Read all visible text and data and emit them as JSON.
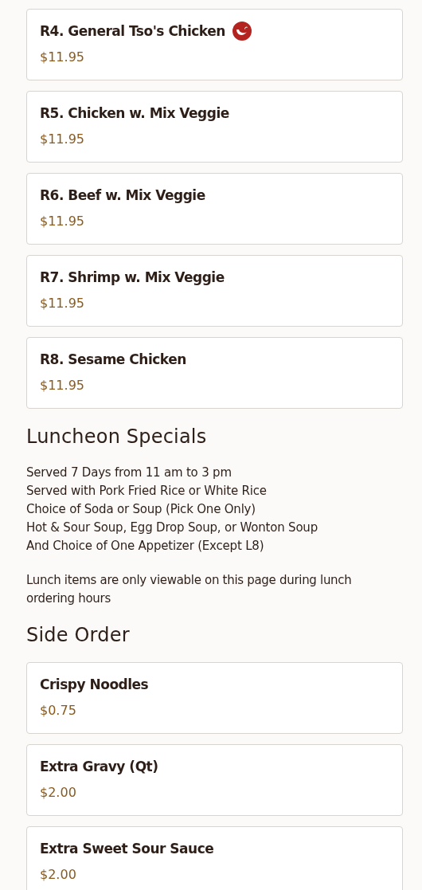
{
  "items": [
    {
      "name": "R4. General Tso's Chicken",
      "spicy": true,
      "price": "$11.95"
    },
    {
      "name": "R5. Chicken w. Mix Veggie",
      "spicy": false,
      "price": "$11.95"
    },
    {
      "name": "R6. Beef w. Mix Veggie",
      "spicy": false,
      "price": "$11.95"
    },
    {
      "name": "R7. Shrimp w. Mix Veggie",
      "spicy": false,
      "price": "$11.95"
    },
    {
      "name": "R8. Sesame Chicken",
      "spicy": false,
      "price": "$11.95"
    }
  ],
  "sections": [
    {
      "title": "Luncheon Specials",
      "lines": [
        "Served 7 Days from 11 am to 3 pm",
        "Served with Pork Fried Rice or White Rice",
        "Choice of Soda or Soup (Pick One Only)",
        "Hot & Sour Soup, Egg Drop Soup, or Wonton Soup",
        "And Choice of One Appetizer (Except L8)"
      ],
      "note": "Lunch items are only viewable on this page during lunch ordering hours"
    },
    {
      "title": "Side Order",
      "items": [
        {
          "name": "Crispy Noodles",
          "spicy": false,
          "price": "$0.75"
        },
        {
          "name": "Extra Gravy (Qt)",
          "spicy": false,
          "price": "$2.00"
        },
        {
          "name": "Extra Sweet Sour Sauce",
          "spicy": false,
          "price": "$2.00"
        }
      ]
    }
  ]
}
